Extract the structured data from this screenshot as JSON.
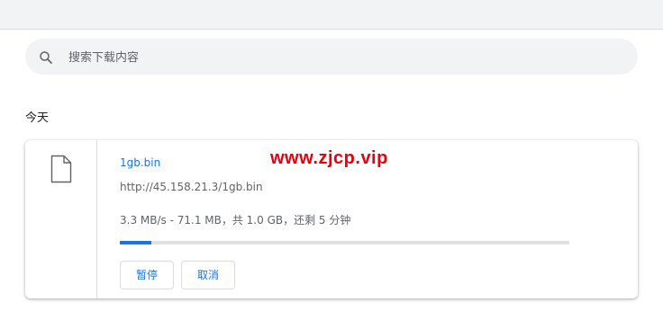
{
  "search": {
    "placeholder": "搜索下载内容"
  },
  "section": {
    "title": "今天"
  },
  "download": {
    "filename": "1gb.bin",
    "url": "http://45.158.21.3/1gb.bin",
    "status": "3.3 MB/s - 71.1 MB，共 1.0 GB，还剩 5 分钟",
    "progress_fraction": 0.071,
    "pause_label": "暂停",
    "cancel_label": "取消",
    "file_icon": "file-icon"
  },
  "watermark": "www.zjcp.vip",
  "colors": {
    "accent": "#1a73e8",
    "watermark": "#e8000f",
    "track": "#e0e0e0"
  }
}
